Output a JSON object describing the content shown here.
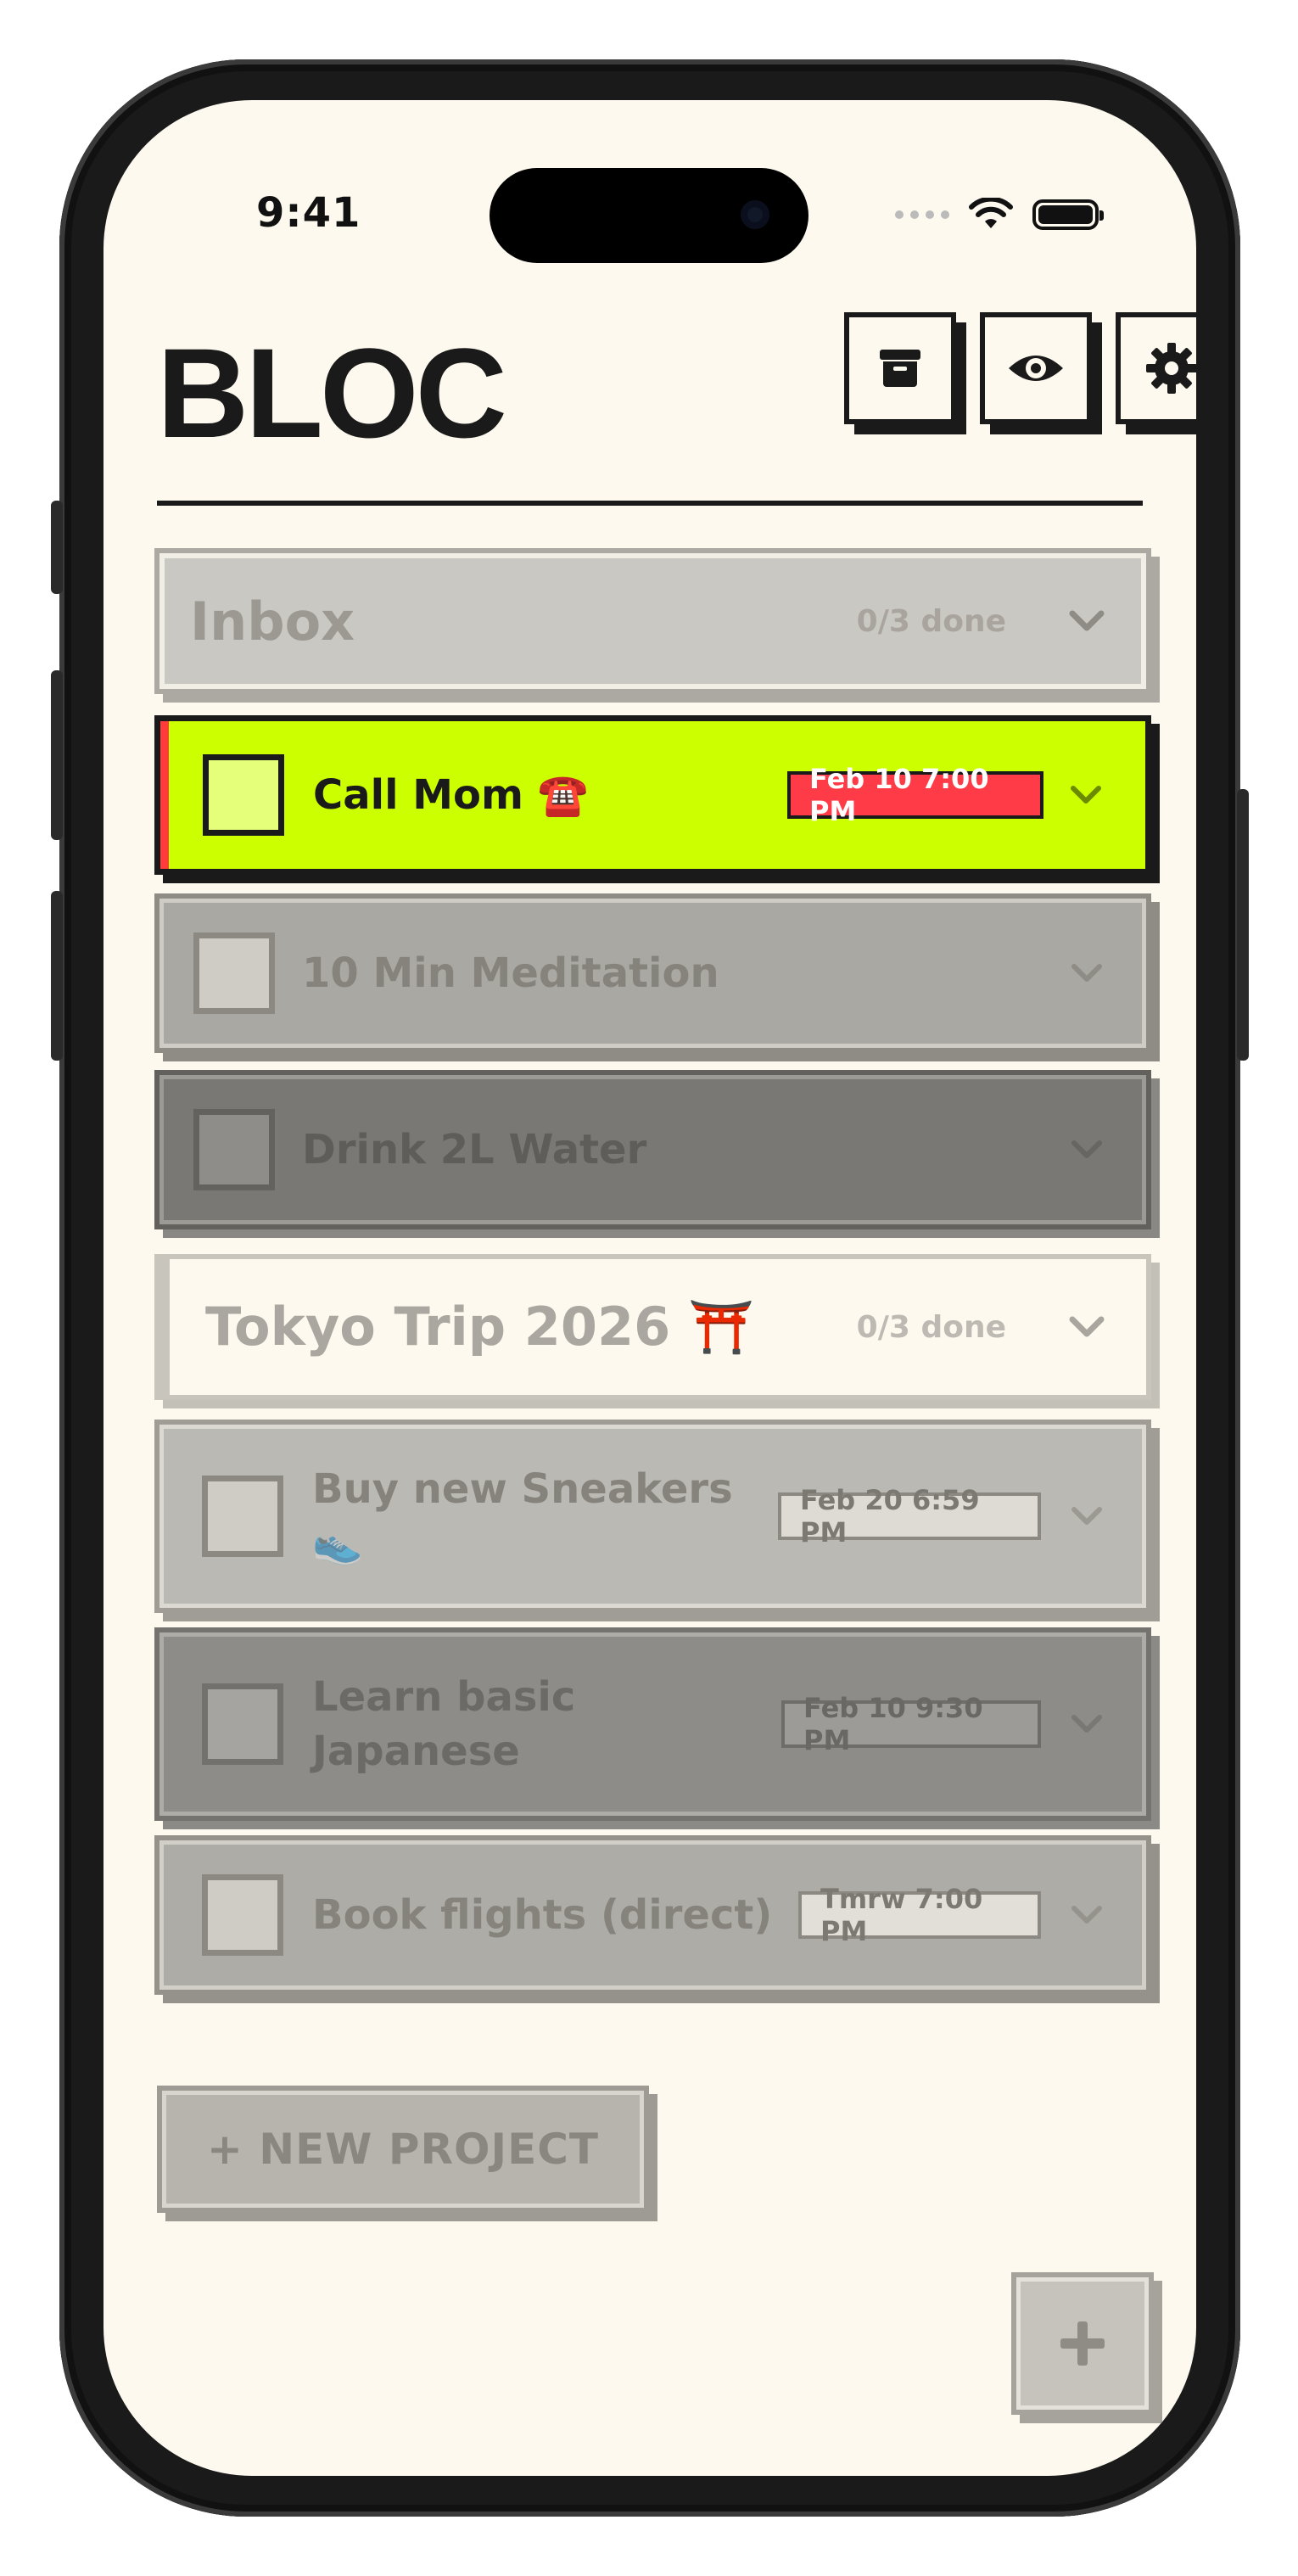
{
  "status_bar": {
    "time": "9:41"
  },
  "header": {
    "logo": "BLOC",
    "buttons": [
      {
        "icon": "archive-icon"
      },
      {
        "icon": "eye-icon"
      },
      {
        "icon": "gear-icon"
      }
    ]
  },
  "projects": [
    {
      "title": "Inbox",
      "progress": "0/3 done",
      "tasks": [
        {
          "name": "Call Mom ☎️",
          "date": "Feb 10 7:00 PM",
          "active": true
        },
        {
          "name": "10 Min Meditation",
          "date": ""
        },
        {
          "name": "Drink 2L Water",
          "date": ""
        }
      ]
    },
    {
      "title": "Tokyo Trip 2026 ⛩️",
      "progress": "0/3 done",
      "tasks": [
        {
          "name_line1": "Buy new Sneakers",
          "name_line2": "👟",
          "date": "Feb 20 6:59 PM"
        },
        {
          "name_line1": "Learn basic",
          "name_line2": "Japanese",
          "date": "Feb 10 9:30 PM"
        },
        {
          "name": "Book flights (direct)",
          "date": "Tmrw 7:00 PM"
        }
      ]
    }
  ],
  "new_project_label": "+ NEW PROJECT",
  "fab_icon": "plus-icon",
  "colors": {
    "accent_lime": "#ccff00",
    "urgent_red": "#ff3b47",
    "background": "#fdf9ee",
    "ink": "#1a1a1a"
  }
}
